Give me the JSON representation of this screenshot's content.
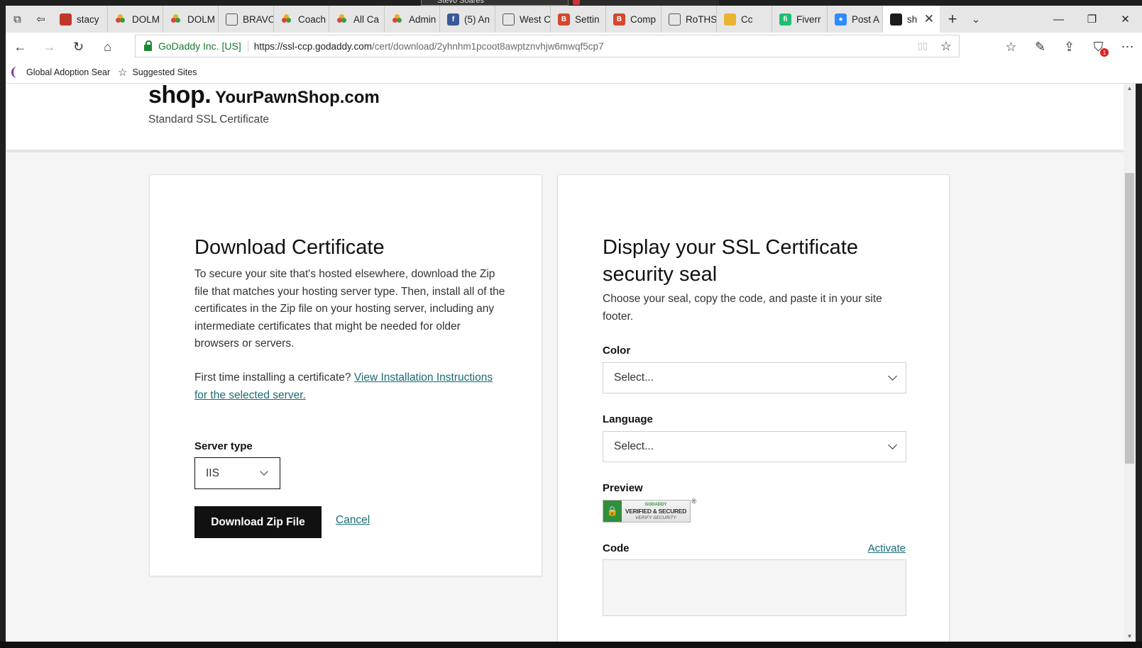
{
  "overlay": {
    "title": "Stevo Soares"
  },
  "tabs": [
    {
      "label": "stacy",
      "icon": "pdf-icon"
    },
    {
      "label": "DOLM",
      "icon": "colored-dots-icon"
    },
    {
      "label": "DOLM",
      "icon": "colored-dots-icon"
    },
    {
      "label": "BRAVO",
      "icon": "page-icon"
    },
    {
      "label": "Coach",
      "icon": "colored-dots-icon"
    },
    {
      "label": "All Ca",
      "icon": "colored-dots-icon"
    },
    {
      "label": "Admin",
      "icon": "colored-dots-icon"
    },
    {
      "label": "(5) An",
      "icon": "facebook-icon"
    },
    {
      "label": "West C",
      "icon": "page-icon"
    },
    {
      "label": "Settin",
      "icon": "b-icon"
    },
    {
      "label": "Comp",
      "icon": "b-icon"
    },
    {
      "label": "RoTHS",
      "icon": "page-icon"
    },
    {
      "label": "Cc",
      "icon": "thumbs-icon"
    },
    {
      "label": "Fiverr",
      "icon": "fiverr-icon"
    },
    {
      "label": "Post A",
      "icon": "zoom-icon"
    },
    {
      "label": "sh",
      "icon": "godaddy-icon",
      "active": true
    }
  ],
  "address_bar": {
    "identity": "GoDaddy Inc. [US]",
    "url_host": "https://ssl-ccp.godaddy.com",
    "url_path": "/cert/download/2yhnhm1pcoot8awptznvhjw6mwqf5cp7"
  },
  "favorites": [
    {
      "label": "Global Adoption Sear"
    },
    {
      "label": "Suggested Sites"
    }
  ],
  "notification_count": "1",
  "header": {
    "brand_tld": "shop.",
    "brand_domain": "YourPawnShop.com",
    "cert_type": "Standard SSL Certificate"
  },
  "download": {
    "title": "Download Certificate",
    "description": "To secure your site that's hosted elsewhere, download the Zip file that matches your hosting server type. Then, install all of the certificates in the Zip file on your hosting server, including any intermediate certificates that might be needed for older browsers or servers.",
    "first_time_text": "First time installing a certificate? ",
    "instructions_link": "View Installation Instructions for the selected server.",
    "server_type_label": "Server type",
    "server_type_value": "IIS",
    "download_button": "Download Zip File",
    "cancel_link": "Cancel"
  },
  "seal": {
    "title": "Display your SSL Certificate security seal",
    "description": "Choose your seal, copy the code, and paste it in your site footer.",
    "color_label": "Color",
    "color_value": "Select...",
    "language_label": "Language",
    "language_value": "Select...",
    "preview_label": "Preview",
    "seal_brand": "GODADDY",
    "seal_main": "VERIFIED & SECURED",
    "seal_sub": "VERIFY SECURITY",
    "code_label": "Code",
    "activate_link": "Activate"
  }
}
